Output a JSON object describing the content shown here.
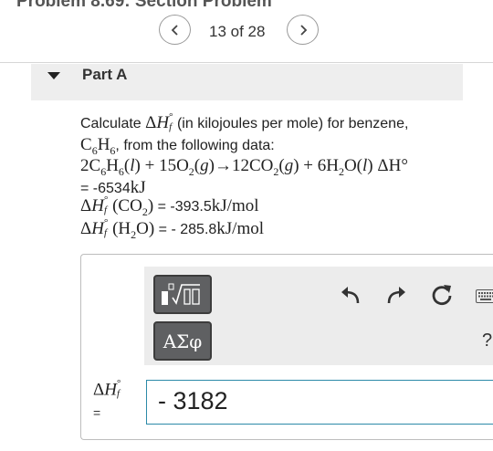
{
  "header": {
    "title": "Problem 8.69: Section Problem",
    "page_counter": "13 of 28",
    "prev_icon": "chevron-left-icon",
    "next_icon": "chevron-right-icon"
  },
  "part": {
    "label": "Part A",
    "expanded": true
  },
  "question": {
    "line1_calculate": "Calculate ",
    "line1_rest": " (in kilojoules per mole) for benzene,",
    "line2_rest": ", from the following data:",
    "reaction": "2C6H6(l) + 15O2(g)→12CO2(g) + 6H2O(l) ΔH°",
    "reaction_value": "= -6534",
    "reaction_unit": "kJ",
    "co2_eq": " = -393.5",
    "co2_unit": "kJ/mol",
    "h2o_eq": " = - 285.8",
    "h2o_unit": "kJ/mol"
  },
  "toolbar": {
    "template_icon": "templates-icon",
    "greek_label": "ΑΣφ",
    "undo_icon": "undo-icon",
    "redo_icon": "redo-icon",
    "reset_icon": "reset-icon",
    "keyboard_icon": "keyboard-icon",
    "help_label": "?"
  },
  "answer": {
    "equals": "=",
    "value": "- 3182"
  }
}
